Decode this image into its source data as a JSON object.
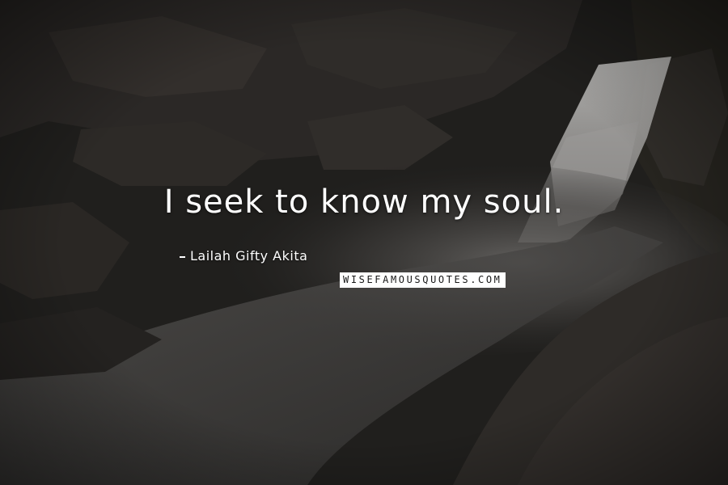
{
  "quote": {
    "text": "I seek to know my soul.",
    "author": "Lailah Gifty Akita"
  },
  "watermark": {
    "text": "WISEFAMOUSQUOTES.COM"
  },
  "background": {
    "description_icon": "waterfall-photo",
    "tone": "#1a1918"
  }
}
